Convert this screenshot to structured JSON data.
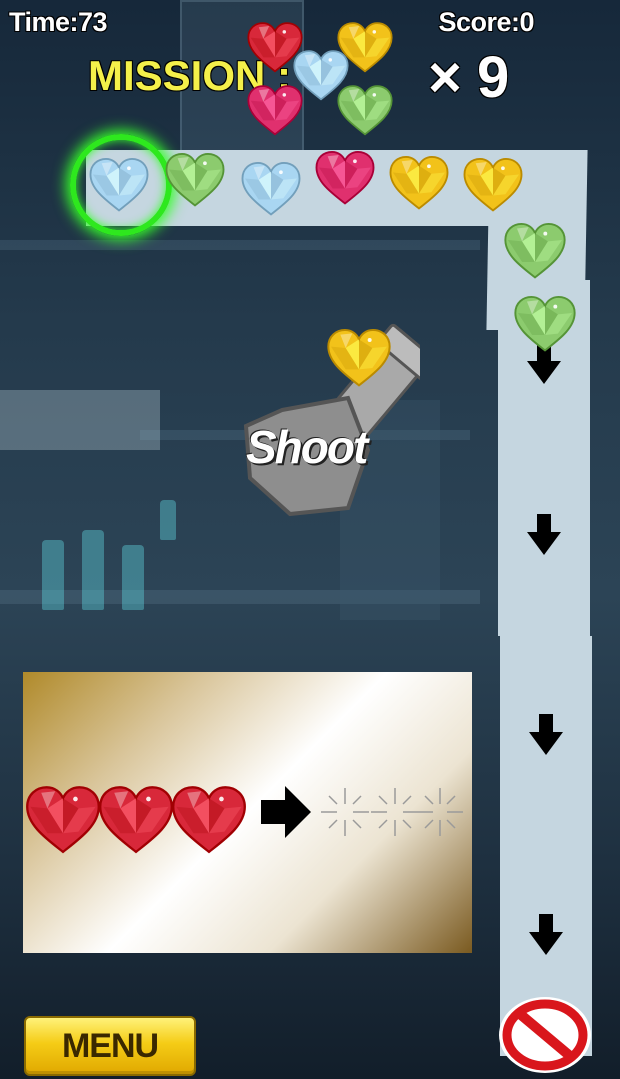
{
  "hud": {
    "time_label": "Time:73",
    "score_label": "Score:0"
  },
  "mission": {
    "label": "MISSION :",
    "multiplier": "× 9",
    "hearts": [
      "red",
      "yellow",
      "blue",
      "pink",
      "green"
    ]
  },
  "chain": {
    "hearts": [
      "blue",
      "green",
      "blue",
      "pink",
      "yellow",
      "yellow",
      "green",
      "green"
    ],
    "target_marked": "blue"
  },
  "cannon": {
    "loaded_heart": "yellow",
    "button_label": "Shoot"
  },
  "hint": {
    "hearts": [
      "red",
      "red",
      "red"
    ],
    "result": "sparkle"
  },
  "menu": {
    "label": "MENU"
  },
  "icons": {
    "track_arrow": "arrow-down-icon",
    "hint_arrow": "arrow-right-icon",
    "end_marker": "no-entry-icon"
  },
  "colors": {
    "red": "#d8283a",
    "yellow": "#f2c21a",
    "blue": "#a9d6f2",
    "pink": "#e0306e",
    "green": "#8ccb6e",
    "mission_text": "#f4f04a",
    "track": "#c5d6e0"
  }
}
